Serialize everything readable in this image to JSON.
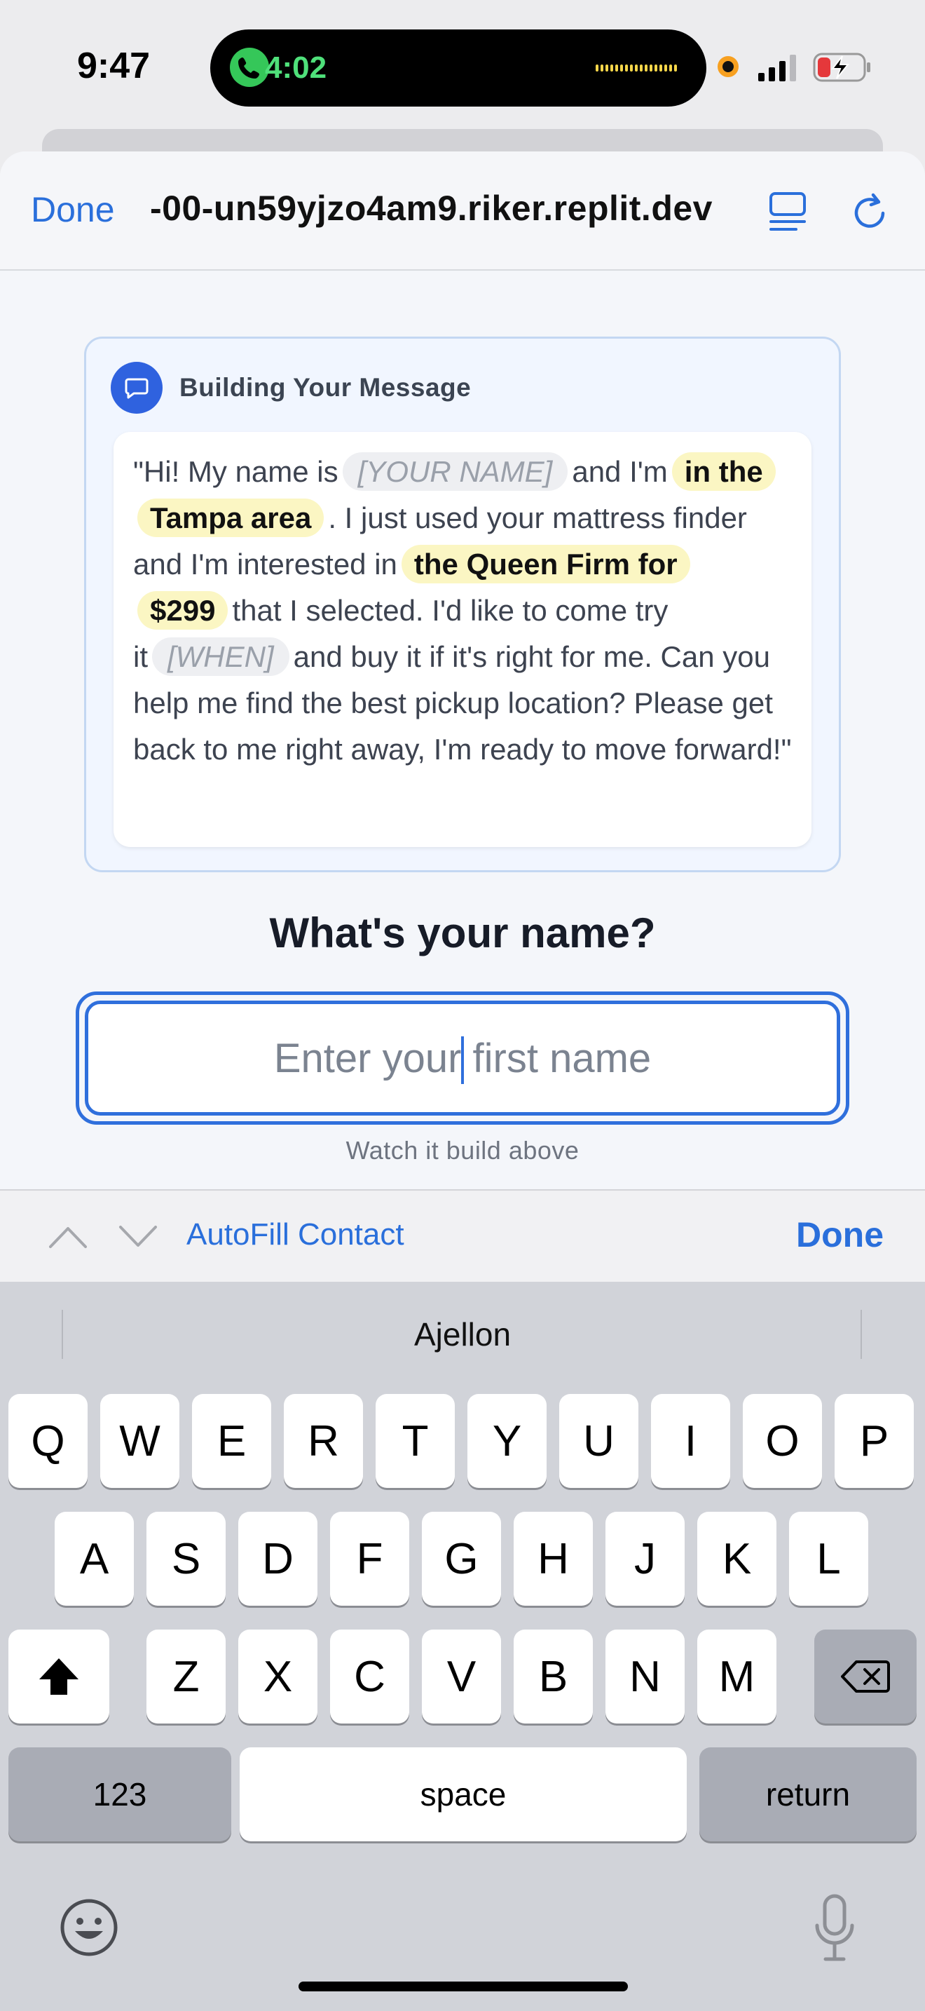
{
  "status_bar": {
    "time": "9:47",
    "call_time": "4:02",
    "icons": [
      "phone-icon",
      "audio-wave-icon",
      "recording-dot-icon",
      "signal-icon",
      "battery-charging-icon"
    ]
  },
  "browser": {
    "done_label": "Done",
    "url": "-00-un59yjzo4am9.riker.replit.dev",
    "icons": [
      "tabs-icon",
      "reload-icon"
    ]
  },
  "card": {
    "title": "Building Your Message",
    "icon": "chat-bubble-icon",
    "message": {
      "part1": "\"Hi! My name is",
      "name_placeholder": "[YOUR NAME]",
      "part2": "and I'm",
      "location": "in the Tampa area",
      "part3": ". I just used your mattress finder and I'm interested in",
      "product": "the Queen Firm for $299",
      "part4": "that I selected. I'd like to come try it",
      "when_placeholder": "[WHEN]",
      "part5": "and buy it if it's right for me. Can you help me find the best pickup location? Please get back to me right away, I'm ready to move forward!\""
    }
  },
  "form": {
    "question": "What's your name?",
    "name_value": "",
    "name_placeholder": "Enter your first name",
    "hint": "Watch it build above"
  },
  "accessory_bar": {
    "autofill_label": "AutoFill Contact",
    "done_label": "Done",
    "icons": [
      "chevron-up-icon",
      "chevron-down-icon"
    ]
  },
  "keyboard": {
    "suggestion": "Ajellon",
    "row1": [
      "Q",
      "W",
      "E",
      "R",
      "T",
      "Y",
      "U",
      "I",
      "O",
      "P"
    ],
    "row2": [
      "A",
      "S",
      "D",
      "F",
      "G",
      "H",
      "J",
      "K",
      "L"
    ],
    "row3": [
      "Z",
      "X",
      "C",
      "V",
      "B",
      "N",
      "M"
    ],
    "numbers_label": "123",
    "space_label": "space",
    "return_label": "return",
    "icons": [
      "shift-icon",
      "backspace-icon",
      "emoji-icon",
      "microphone-icon"
    ]
  },
  "colors": {
    "accent": "#2f6fdc",
    "highlight": "#fbf6c3",
    "card_bg": "#f1f6ff",
    "keyboard_bg": "#d1d3d9"
  }
}
